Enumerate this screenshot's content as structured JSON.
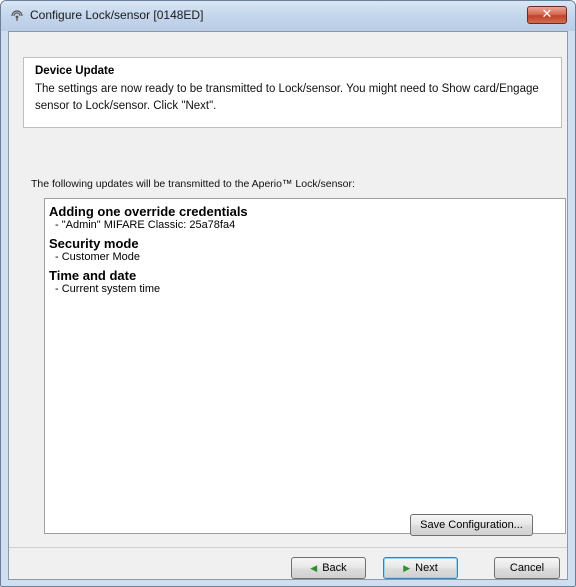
{
  "window": {
    "title": "Configure Lock/sensor [0148ED]",
    "close_label": "✕"
  },
  "header": {
    "title": "Device Update",
    "description": "The settings are now ready to be transmitted to Lock/sensor. You might need to Show card/Engage sensor to Lock/sensor. Click \"Next\"."
  },
  "intro_text": "The following updates will be transmitted to the Aperio™ Lock/sensor:",
  "updates": [
    {
      "title": "Adding one override credentials",
      "items": [
        "- \"Admin\" MIFARE Classic: 25a78fa4"
      ]
    },
    {
      "title": "Security mode",
      "items": [
        "- Customer Mode"
      ]
    },
    {
      "title": "Time and date",
      "items": [
        "- Current system time"
      ]
    }
  ],
  "buttons": {
    "save_configuration": "Save Configuration...",
    "back": "Back",
    "next": "Next",
    "cancel": "Cancel"
  },
  "icons": {
    "title_icon": "wireless-lock-icon",
    "back_icon": "arrow-left-icon",
    "next_icon": "arrow-right-icon"
  }
}
